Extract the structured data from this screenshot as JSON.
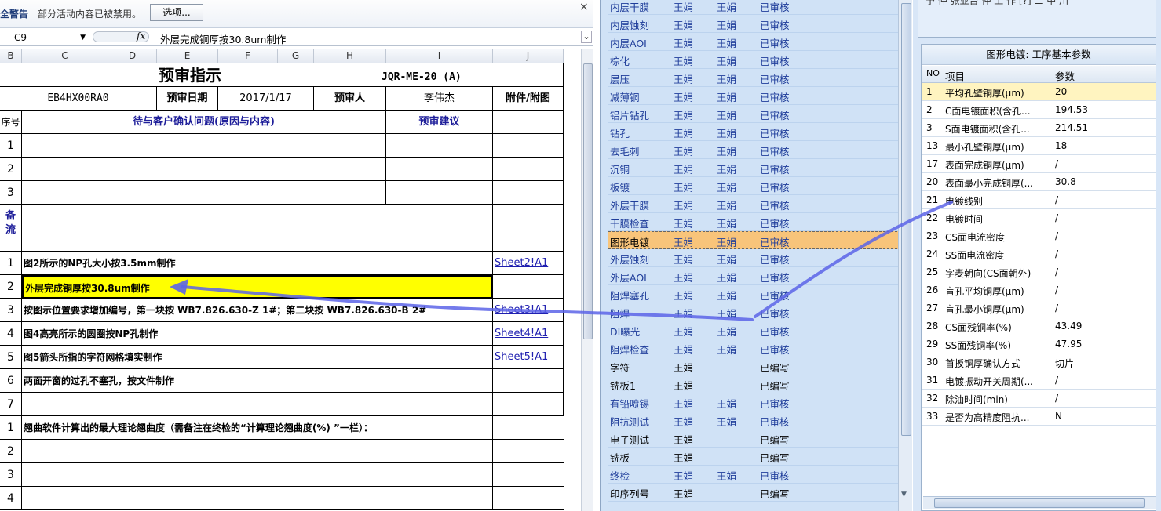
{
  "security_bar": {
    "warning": "全警告",
    "message": "部分活动内容已被禁用。",
    "options_button": "选项...",
    "close": "×"
  },
  "formula_bar": {
    "name_box": "C9",
    "fx": "fx",
    "value": "外层完成铜厚按30.8um制作",
    "expand": "≚"
  },
  "columns": [
    "B",
    "C",
    "D",
    "E",
    "F",
    "G",
    "H",
    "I",
    "J"
  ],
  "sheet": {
    "title": "预审指示",
    "doc_no": "JQR-ME-20 (A)",
    "part_no": "EB4HX00RA0",
    "review_date_label": "预审日期",
    "review_date": "2017/1/17",
    "reviewer_label": "预审人",
    "reviewer": "李伟杰",
    "attach_label": "附件/附图",
    "seq_label": "序号",
    "issue_label": "待与客户确认问题(原因与内容)",
    "suggest_label": "预审建议",
    "blank_rows": [
      "1",
      "2",
      "3"
    ],
    "remark_label": "备\n流",
    "items": [
      {
        "no": "1",
        "text": "图2所示的NP孔大小按3.5mm制作",
        "link": "Sheet2!A1"
      },
      {
        "no": "2",
        "text": "外层完成铜厚按30.8um制作",
        "link": ""
      },
      {
        "no": "3",
        "text": "按图示位置要求增加编号，第一块按  WB7.826.630-Z 1#；第二块按  WB7.826.630-B 2#",
        "link": "Sheet3!A1"
      },
      {
        "no": "4",
        "text": "图4高亮所示的圆圈按NP孔制作",
        "link": "Sheet4!A1"
      },
      {
        "no": "5",
        "text": "图5箭头所指的字符网格填实制作",
        "link": "Sheet5!A1"
      },
      {
        "no": "6",
        "text": "两面开窗的过孔不塞孔，按文件制作",
        "link": ""
      },
      {
        "no": "7",
        "text": "",
        "link": ""
      }
    ],
    "warp_items": [
      {
        "no": "1",
        "text": "翘曲软件计算出的最大理论翘曲度（需备注在终检的“计算理论翘曲度(%) ”一栏）："
      },
      {
        "no": "2",
        "text": ""
      },
      {
        "no": "3",
        "text": ""
      },
      {
        "no": "4",
        "text": ""
      }
    ]
  },
  "process_list": [
    {
      "name": "内层干膜",
      "a": "王娟",
      "b": "王娟",
      "status": "已审核"
    },
    {
      "name": "内层蚀刻",
      "a": "王娟",
      "b": "王娟",
      "status": "已审核"
    },
    {
      "name": "内层AOI",
      "a": "王娟",
      "b": "王娟",
      "status": "已审核"
    },
    {
      "name": "棕化",
      "a": "王娟",
      "b": "王娟",
      "status": "已审核"
    },
    {
      "name": "层压",
      "a": "王娟",
      "b": "王娟",
      "status": "已审核"
    },
    {
      "name": "减薄铜",
      "a": "王娟",
      "b": "王娟",
      "status": "已审核"
    },
    {
      "name": "铝片钻孔",
      "a": "王娟",
      "b": "王娟",
      "status": "已审核"
    },
    {
      "name": "钻孔",
      "a": "王娟",
      "b": "王娟",
      "status": "已审核"
    },
    {
      "name": "去毛刺",
      "a": "王娟",
      "b": "王娟",
      "status": "已审核"
    },
    {
      "name": "沉铜",
      "a": "王娟",
      "b": "王娟",
      "status": "已审核"
    },
    {
      "name": "板镀",
      "a": "王娟",
      "b": "王娟",
      "status": "已审核"
    },
    {
      "name": "外层干膜",
      "a": "王娟",
      "b": "王娟",
      "status": "已审核"
    },
    {
      "name": "干膜检查",
      "a": "王娟",
      "b": "王娟",
      "status": "已审核"
    },
    {
      "name": "图形电镀",
      "a": "王娟",
      "b": "王娟",
      "status": "已审核"
    },
    {
      "name": "外层蚀刻",
      "a": "王娟",
      "b": "王娟",
      "status": "已审核"
    },
    {
      "name": "外层AOI",
      "a": "王娟",
      "b": "王娟",
      "status": "已审核"
    },
    {
      "name": "阻焊塞孔",
      "a": "王娟",
      "b": "王娟",
      "status": "已审核"
    },
    {
      "name": "阻焊",
      "a": "王娟",
      "b": "王娟",
      "status": "已审核"
    },
    {
      "name": "DI曝光",
      "a": "王娟",
      "b": "王娟",
      "status": "已审核"
    },
    {
      "name": "阻焊检查",
      "a": "王娟",
      "b": "王娟",
      "status": "已审核"
    },
    {
      "name": "字符",
      "a": "王娟",
      "b": "",
      "status": "已编写"
    },
    {
      "name": "铣板1",
      "a": "王娟",
      "b": "",
      "status": "已编写"
    },
    {
      "name": "有铅喷锡",
      "a": "王娟",
      "b": "王娟",
      "status": "已审核"
    },
    {
      "name": "阻抗测试",
      "a": "王娟",
      "b": "王娟",
      "status": "已审核"
    },
    {
      "name": "电子测试",
      "a": "王娟",
      "b": "",
      "status": "已编写"
    },
    {
      "name": "铣板",
      "a": "王娟",
      "b": "",
      "status": "已编写"
    },
    {
      "name": "终检",
      "a": "王娟",
      "b": "王娟",
      "status": "已审核"
    },
    {
      "name": "印序列号",
      "a": "王娟",
      "b": "",
      "status": "已编写"
    }
  ],
  "selected_process": "图形电镀",
  "params_panel": {
    "top_partial": "予 仲 张亚台 仲 工  作  [?] 二  中  川",
    "title": "图形电镀: 工序基本参数",
    "col_no": "NO",
    "col_item": "项目",
    "col_value": "参数",
    "rows": [
      {
        "no": "1",
        "item": "平均孔壁铜厚(μm)",
        "value": "20"
      },
      {
        "no": "2",
        "item": "C面电镀面积(含孔...",
        "value": "194.53"
      },
      {
        "no": "3",
        "item": "S面电镀面积(含孔...",
        "value": "214.51"
      },
      {
        "no": "13",
        "item": "最小孔壁铜厚(μm)",
        "value": "18"
      },
      {
        "no": "17",
        "item": "表面完成铜厚(μm)",
        "value": "/"
      },
      {
        "no": "20",
        "item": "表面最小完成铜厚(...",
        "value": "30.8"
      },
      {
        "no": "21",
        "item": "电镀线别",
        "value": "/"
      },
      {
        "no": "22",
        "item": "电镀时间",
        "value": "/"
      },
      {
        "no": "23",
        "item": "CS面电流密度",
        "value": "/"
      },
      {
        "no": "24",
        "item": "SS面电流密度",
        "value": "/"
      },
      {
        "no": "25",
        "item": "字麦朝向(CS面朝外)",
        "value": "/"
      },
      {
        "no": "26",
        "item": "盲孔平均铜厚(μm)",
        "value": "/"
      },
      {
        "no": "27",
        "item": "盲孔最小铜厚(μm)",
        "value": "/"
      },
      {
        "no": "28",
        "item": "CS面残铜率(%)",
        "value": "43.49"
      },
      {
        "no": "29",
        "item": "SS面残铜率(%)",
        "value": "47.95"
      },
      {
        "no": "30",
        "item": "首扳铜厚确认方式",
        "value": "切片"
      },
      {
        "no": "31",
        "item": "电镀振动开关周期(...",
        "value": "/"
      },
      {
        "no": "32",
        "item": "除油时间(min)",
        "value": "/"
      },
      {
        "no": "33",
        "item": "是否为高精度阻抗...",
        "value": "N"
      }
    ]
  },
  "colors": {
    "highlight": "#ffff00",
    "selection": "#f8c47a",
    "arrow": "#5c64e8",
    "header_blue": "#1f1f9a"
  }
}
